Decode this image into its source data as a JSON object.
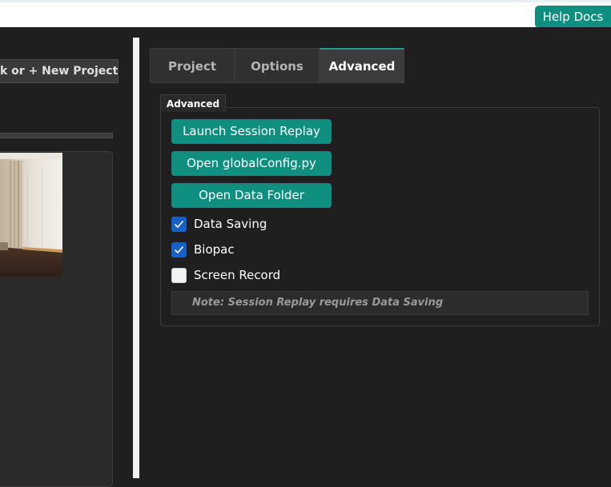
{
  "header": {
    "help_label": "Help Docs"
  },
  "left_panel": {
    "project_button_label": "k or + New Project",
    "preview_image": "room-photo"
  },
  "tabs": [
    {
      "label": "Project",
      "active": false
    },
    {
      "label": "Options",
      "active": false
    },
    {
      "label": "Advanced",
      "active": true
    }
  ],
  "advanced": {
    "group_title": "Advanced",
    "buttons": [
      {
        "label": "Launch Session Replay"
      },
      {
        "label": "Open globalConfig.py"
      },
      {
        "label": "Open Data Folder"
      }
    ],
    "checkboxes": [
      {
        "label": "Data Saving",
        "checked": true
      },
      {
        "label": "Biopac",
        "checked": true
      },
      {
        "label": "Screen Record",
        "checked": false
      }
    ],
    "note": "Note: Session Replay requires Data Saving"
  },
  "colors": {
    "accent": "#0f8f80",
    "checkbox_on": "#1860c9",
    "background": "#1f1f1f"
  }
}
